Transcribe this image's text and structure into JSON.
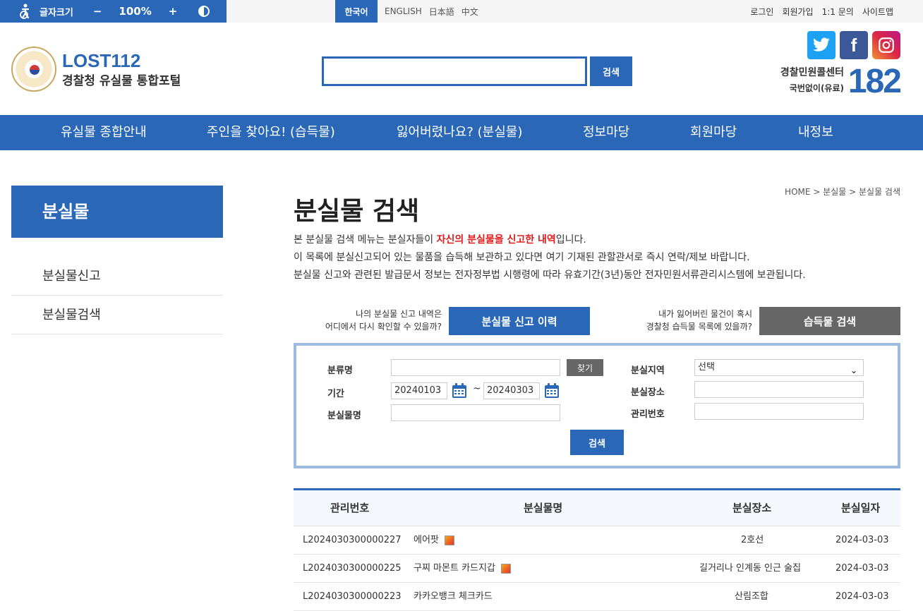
{
  "topbar": {
    "font_size_label": "글자크기",
    "minus": "−",
    "zoom": "100%",
    "plus": "+",
    "languages": [
      "한국어",
      "ENGLISH",
      "日本語",
      "中文"
    ],
    "util_links": [
      "로그인",
      "회원가입",
      "1:1 문의",
      "사이트맵"
    ]
  },
  "header": {
    "brand": "LOST112",
    "subtitle": "경찰청 유실물 통합포털",
    "search_button": "검색",
    "call_center_label": "경찰민원콜센터",
    "call_center_sub": "국번없이(유료)",
    "call_center_number": "182"
  },
  "nav": [
    "유실물 종합안내",
    "주인을 찾아요! (습득물)",
    "잃어버렸나요? (분실물)",
    "정보마당",
    "회원마당",
    "내정보"
  ],
  "sidebar": {
    "title": "분실물",
    "items": [
      "분실물신고",
      "분실물검색"
    ]
  },
  "main": {
    "breadcrumb": [
      "HOME",
      "분실물",
      "분실물 검색"
    ],
    "title": "분실물 검색",
    "desc1_pre": "본 분실물 검색 메뉴는 분실자들이 ",
    "desc1_hl": "자신의 분실물을 신고한 내역",
    "desc1_post": "입니다.",
    "desc2": "이 목록에 분실신고되어 있는 물품을 습득해 보관하고 있다면 여기 기재된 관할관서로 즉시 연락/제보 바랍니다.",
    "desc3": "분실물 신고와 관련된 발급문서 정보는 전자정부법 시행령에 따라 유효기간(3년)동안 전자민원서류관리시스템에 보관됩니다.",
    "q1_line1": "나의 분실물 신고 내역은",
    "q1_line2": "어디에서 다시 확인할 수 있을까?",
    "btn_history": "분실물 신고 이력",
    "q2_line1": "내가 잃어버린 물건이 혹시",
    "q2_line2": "경찰청 습득물 목록에 있을까?",
    "btn_found": "습득물 검색"
  },
  "form": {
    "category_label": "분류명",
    "category_value": "",
    "find_button": "찾기",
    "period_label": "기간",
    "date_from": "20240103",
    "tilde": "~",
    "date_to": "20240303",
    "item_name_label": "분실물명",
    "item_name_value": "",
    "region_label": "분실지역",
    "region_selected": "선택",
    "place_label": "분실장소",
    "place_value": "",
    "mgmt_no_label": "관리번호",
    "mgmt_no_value": "",
    "search_button": "검색"
  },
  "table": {
    "headers": [
      "관리번호",
      "분실물명",
      "분실장소",
      "분실일자"
    ],
    "rows": [
      {
        "id": "L2024030300000227",
        "name": "에어팟",
        "place": "2호선",
        "date": "2024-03-03"
      },
      {
        "id": "L2024030300000225",
        "name": "구찌 마몬트 카드지갑",
        "place": "길거리나 인계동 인근 술집",
        "date": "2024-03-03"
      },
      {
        "id": "L2024030300000223",
        "name": "카카오뱅크 체크카드",
        "place": "산림조합",
        "date": "2024-03-03"
      }
    ]
  },
  "colors": {
    "primary": "#2a67b7",
    "highlight": "#e21a1a",
    "gray_button": "#666666",
    "form_border": "#9dbbe0"
  },
  "icons": [
    "accessibility-icon",
    "contrast-icon",
    "twitter-icon",
    "facebook-icon",
    "instagram-icon",
    "calendar-icon",
    "image-icon"
  ]
}
